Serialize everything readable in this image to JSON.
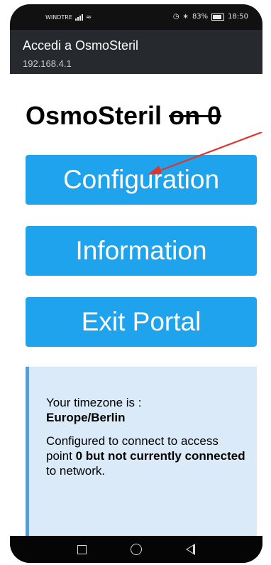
{
  "status_bar": {
    "carrier": "WINDTRE",
    "battery": "83%",
    "time": "18:50",
    "icons": [
      "signal-icon",
      "wifi-icon",
      "alarm-icon",
      "bluetooth-icon",
      "battery-icon"
    ],
    "battery_level": 0.83
  },
  "portal_header": {
    "title": "Accedi a OsmoSteril",
    "address": "192.168.4.1"
  },
  "page": {
    "heading_main": "OsmoSteril",
    "heading_struck": "on 0"
  },
  "buttons": {
    "configuration": "Configuration",
    "information": "Information",
    "exit_portal": "Exit Portal"
  },
  "info_box": {
    "timezone_label": "Your timezone is :",
    "timezone_value": "Europe/Berlin",
    "status_prefix": "Configured to connect to access point",
    "status_bold": "0 but not currently connected",
    "status_suffix": "to network."
  },
  "colors": {
    "button_blue": "#1fa3ec",
    "info_background": "#dbeaf8",
    "info_border": "#5d9bd3",
    "header_bg": "#262a2e",
    "annotation_arrow": "#e0352b"
  },
  "nav_bar": {
    "icons": [
      "recents-square-icon",
      "home-circle-icon",
      "back-triangle-icon"
    ]
  }
}
